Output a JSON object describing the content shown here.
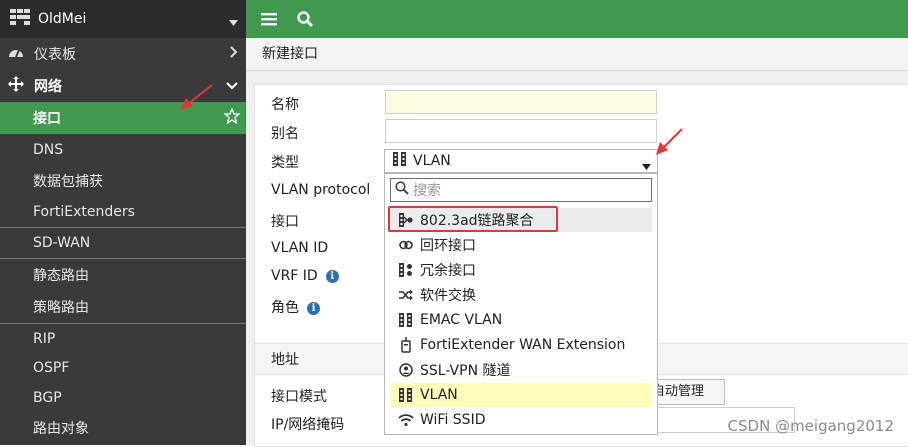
{
  "sidebar": {
    "device_name": "OldMei",
    "items": [
      {
        "label": "仪表板"
      },
      {
        "label": "网络"
      },
      {
        "label": "接口"
      },
      {
        "label": "DNS"
      },
      {
        "label": "数据包捕获"
      },
      {
        "label": "FortiExtenders"
      },
      {
        "label": "SD-WAN"
      },
      {
        "label": "静态路由"
      },
      {
        "label": "策略路由"
      },
      {
        "label": "RIP"
      },
      {
        "label": "OSPF"
      },
      {
        "label": "BGP"
      },
      {
        "label": "路由对象"
      }
    ]
  },
  "page": {
    "title": "新建接口"
  },
  "form": {
    "name_label": "名称",
    "alias_label": "别名",
    "type_label": "类型",
    "vlan_protocol_label": "VLAN protocol",
    "interface_label": "接口",
    "vlan_id_label": "VLAN ID",
    "vrf_id_label": "VRF ID",
    "role_label": "角色",
    "address_section": "地址",
    "addressing_mode_label": "接口模式",
    "ip_label": "IP/网络掩码",
    "auto_manage_label": "自动管理"
  },
  "type_dropdown": {
    "selected": "VLAN",
    "search_placeholder": "搜索",
    "options": [
      {
        "label": "802.3ad链路聚合",
        "icon": "aggregate-icon"
      },
      {
        "label": "回环接口",
        "icon": "loopback-icon"
      },
      {
        "label": "冗余接口",
        "icon": "redundant-icon"
      },
      {
        "label": "软件交换",
        "icon": "switch-icon"
      },
      {
        "label": "EMAC VLAN",
        "icon": "vlan-icon"
      },
      {
        "label": "FortiExtender WAN Extension",
        "icon": "extender-icon"
      },
      {
        "label": "SSL-VPN 隧道",
        "icon": "ssl-vpn-icon"
      },
      {
        "label": "VLAN",
        "icon": "vlan-icon"
      },
      {
        "label": "WiFi SSID",
        "icon": "wifi-icon"
      }
    ]
  },
  "watermark": "CSDN @meigang2012",
  "colors": {
    "accent_green": "#3f9a4f",
    "sidebar_bg": "#3a3a3a",
    "highlight_red": "#e0383b",
    "selected_yellow": "#fefcb8"
  }
}
